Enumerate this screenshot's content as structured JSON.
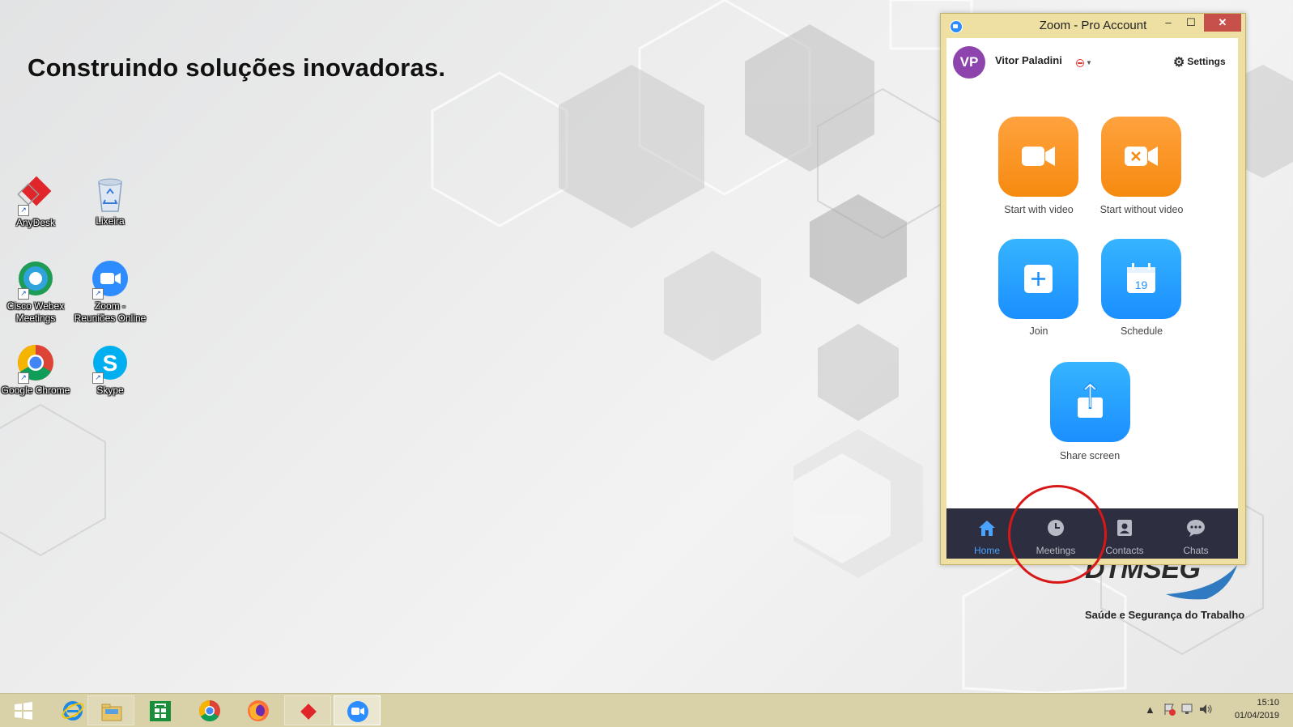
{
  "desktop": {
    "headline": "Construindo soluções inovadoras.",
    "icons": [
      {
        "label": "AnyDesk",
        "icon": "anydesk-icon"
      },
      {
        "label": "Lixeira",
        "icon": "recycle-bin-icon"
      },
      {
        "label": "Cisco Webex Meetings",
        "icon": "webex-icon"
      },
      {
        "label": "Zoom - Reuniões Online",
        "icon": "zoom-icon"
      },
      {
        "label": "Google Chrome",
        "icon": "chrome-icon"
      },
      {
        "label": "Skype",
        "icon": "skype-icon"
      }
    ],
    "brand": {
      "name": "DTMSEG",
      "tagline": "Saúde e Segurança do Trabalho"
    }
  },
  "zoom": {
    "title": "Zoom - Pro Account",
    "window_buttons": {
      "minimize": "–",
      "maximize": "☐",
      "close": "✕"
    },
    "user": {
      "initials": "VP",
      "name": "Vitor Paladini"
    },
    "settings_label": "Settings",
    "actions": {
      "start_video": "Start with video",
      "start_no_video": "Start without video",
      "join": "Join",
      "schedule": "Schedule",
      "share": "Share screen"
    },
    "schedule_day": "19",
    "nav": {
      "home": "Home",
      "meetings": "Meetings",
      "contacts": "Contacts",
      "chats": "Chats"
    },
    "colors": {
      "orange": "#f68a10",
      "blue": "#1a8fff",
      "nav_bg": "#2d2e3f",
      "active": "#4aa3ff",
      "highlight_circle": "#d81818"
    }
  },
  "taskbar": {
    "apps": [
      "start-icon",
      "internet-explorer-icon",
      "file-explorer-icon",
      "store-icon",
      "chrome-icon",
      "firefox-icon",
      "anydesk-icon",
      "zoom-icon"
    ],
    "time": "15:10",
    "date": "01/04/2019"
  }
}
